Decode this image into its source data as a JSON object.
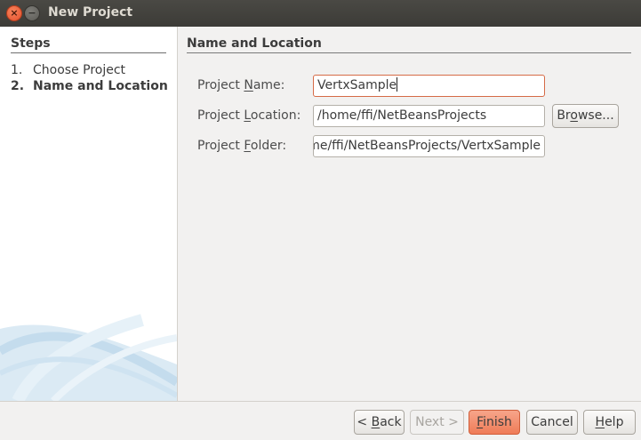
{
  "window": {
    "title": "New Project"
  },
  "steps": {
    "title": "Steps",
    "items": [
      {
        "num": "1.",
        "label": "Choose Project",
        "current": false
      },
      {
        "num": "2.",
        "label": "Name and Location",
        "current": true
      }
    ]
  },
  "section": {
    "title": "Name and Location"
  },
  "form": {
    "name_label_pre": "Project ",
    "name_label_mn": "N",
    "name_label_post": "ame:",
    "name_value": "VertxSample",
    "location_label_pre": "Project ",
    "location_label_mn": "L",
    "location_label_post": "ocation:",
    "location_value": "/home/ffi/NetBeansProjects",
    "folder_label_pre": "Project ",
    "folder_label_mn": "F",
    "folder_label_post": "older:",
    "folder_value": "/home/ffi/NetBeansProjects/VertxSample",
    "browse_pre": "Br",
    "browse_mn": "o",
    "browse_post": "wse..."
  },
  "buttons": {
    "back_pre": "< ",
    "back_mn": "B",
    "back_post": "ack",
    "next": "Next >",
    "finish_mn": "F",
    "finish_post": "inish",
    "cancel": "Cancel",
    "help_mn": "H",
    "help_post": "elp"
  },
  "colors": {
    "accent": "#ef7c58",
    "titlebar": "#3c3b37",
    "focus_border": "#d66b47"
  },
  "icons": {
    "close": "close-icon",
    "minimize": "minimize-icon"
  }
}
